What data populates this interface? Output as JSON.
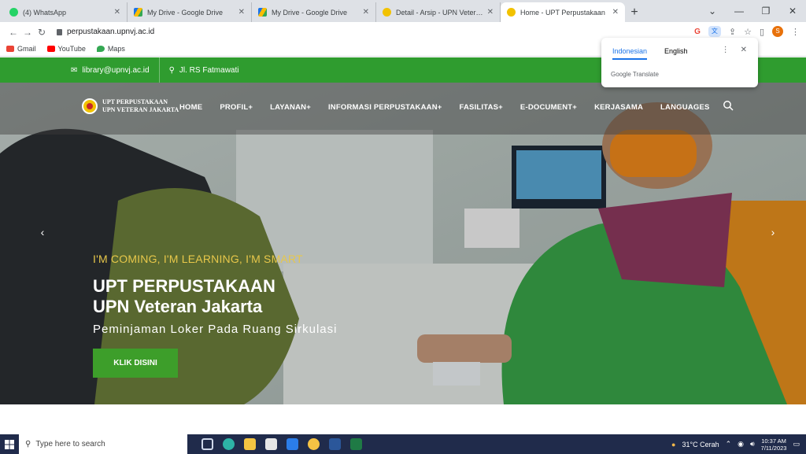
{
  "browser": {
    "tabs": [
      {
        "title": "(4) WhatsApp",
        "color": "#25d366",
        "active": false
      },
      {
        "title": "My Drive - Google Drive",
        "color": "#1a73e8",
        "active": false
      },
      {
        "title": "My Drive - Google Drive",
        "color": "#1a73e8",
        "active": false
      },
      {
        "title": "Detail - Arsip - UPN Veteran Jakar",
        "color": "#f2c200",
        "active": false
      },
      {
        "title": "Home - UPT Perpustakaan",
        "color": "#f2c200",
        "active": true
      }
    ],
    "new_tab_label": "+",
    "url": "perpustakaan.upnvj.ac.id",
    "bookmarks": [
      {
        "label": "Gmail",
        "color": "#ea4335"
      },
      {
        "label": "YouTube",
        "color": "#ff0000"
      },
      {
        "label": "Maps",
        "color": "#34a853"
      }
    ],
    "avatar_letter": "S"
  },
  "translate_popup": {
    "languages": [
      "Indonesian",
      "English"
    ],
    "selected": "Indonesian",
    "footer": "Google Translate"
  },
  "site": {
    "contact": {
      "email": "library@upnvj.ac.id",
      "address": "Jl. RS Fatmawati"
    },
    "logo_line1": "UPT PERPUSTAKAAN",
    "logo_line2": "UPN VETERAN JAKARTA",
    "menu": [
      "HOME",
      "PROFIL+",
      "LAYANAN+",
      "INFORMASI PERPUSTAKAAN+",
      "FASILITAS+",
      "E-DOCUMENT+",
      "KERJASAMA",
      "LANGUAGES"
    ],
    "slide": {
      "tagline": "I'M COMING, I'M LEARNING, I'M SMART",
      "title_line1": "UPT PERPUSTAKAAN",
      "title_line2": "UPN Veteran Jakarta",
      "subtitle": "Peminjaman Loker Pada Ruang Sirkulasi",
      "cta_label": "KLIK DISINI"
    },
    "colors": {
      "green": "#2f9c2f",
      "accent_yellow": "#e7c74a",
      "cta_green": "#3d9e2a"
    }
  },
  "taskbar": {
    "search_placeholder": "Type here to search",
    "weather": "31°C Cerah",
    "time": "10:37 AM",
    "date": "7/11/2023"
  }
}
